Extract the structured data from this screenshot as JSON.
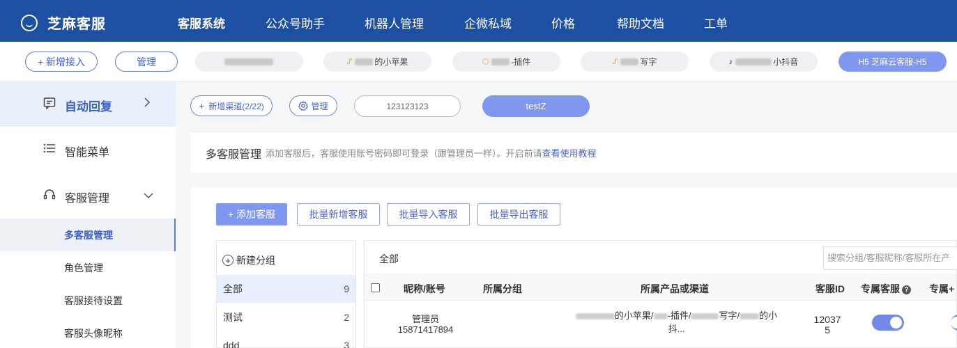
{
  "app": {
    "logo_text": "芝麻客服"
  },
  "nav": [
    "客服系统",
    "公众号助手",
    "机器人管理",
    "企微私域",
    "价格",
    "帮助文档",
    "工单"
  ],
  "channel_bar": {
    "add_button": "+ 新增接入",
    "manage_button": "管理",
    "tabs": [
      {
        "label": ""
      },
      {
        "label": "的小苹果"
      },
      {
        "label": "-插件"
      },
      {
        "label": "写字"
      },
      {
        "label": "小抖音"
      },
      {
        "label": "H5 芝麻云客服-H5"
      }
    ]
  },
  "sidebar": {
    "auto_reply": "自动回复",
    "smart_menu": "智能菜单",
    "cs_manage": "客服管理",
    "sub_items": [
      "多客服管理",
      "角色管理",
      "客服接待设置",
      "客服头像昵称"
    ]
  },
  "sub_channel": {
    "add_label": "新增渠道(2/22)",
    "manage_label": "管理",
    "input_value": "123123123",
    "active_label": "testZ"
  },
  "description": {
    "title": "多客服管理",
    "text": "添加客服后，客服使用账号密码即可登录（跟管理员一样）。开启前请",
    "link": "查看使用教程"
  },
  "actions": {
    "add": "+ 添加客服",
    "batch_add": "批量新增客服",
    "batch_import": "批量导入客服",
    "batch_export": "批量导出客服"
  },
  "groups": {
    "new_group": "新建分组",
    "items": [
      {
        "name": "全部",
        "count": "9"
      },
      {
        "name": "测试",
        "count": "2"
      },
      {
        "name": "ddd",
        "count": "3"
      }
    ]
  },
  "table": {
    "tab_all": "全部",
    "search_placeholder": "搜索分组/客服昵称/客服所在产",
    "columns": [
      "昵称/账号",
      "所属分组",
      "所属产品或渠道",
      "客服ID",
      "专属客服",
      "专属+"
    ],
    "rows": [
      {
        "nickname": "管理员",
        "account": "15871417894",
        "channels_line1": "的小苹果/",
        "channels_mid": "-插件/",
        "channels_mid2": "写字/",
        "channels_end": "的小",
        "channels_line2": "抖...",
        "id_line1": "12037",
        "id_line2": "5",
        "exclusive": true
      }
    ]
  },
  "colors": {
    "brand": "#1d4fa3",
    "accent": "#7f97ee",
    "link": "#4a66c9"
  }
}
